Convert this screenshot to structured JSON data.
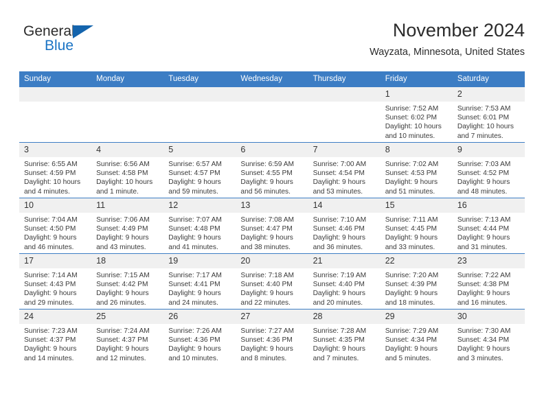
{
  "logo": {
    "word1": "General",
    "word2": "Blue",
    "triangle_color": "#1464ad",
    "blue_color": "#1a73c4"
  },
  "header": {
    "title": "November 2024",
    "subtitle": "Wayzata, Minnesota, United States"
  },
  "theme": {
    "header_bar": "#3c7dc4",
    "daynum_strip": "#f0f0f0",
    "text": "#333333"
  },
  "weekdays": [
    "Sunday",
    "Monday",
    "Tuesday",
    "Wednesday",
    "Thursday",
    "Friday",
    "Saturday"
  ],
  "weeks": [
    [
      {
        "day": "",
        "sunrise": "",
        "sunset": "",
        "daylight": ""
      },
      {
        "day": "",
        "sunrise": "",
        "sunset": "",
        "daylight": ""
      },
      {
        "day": "",
        "sunrise": "",
        "sunset": "",
        "daylight": ""
      },
      {
        "day": "",
        "sunrise": "",
        "sunset": "",
        "daylight": ""
      },
      {
        "day": "",
        "sunrise": "",
        "sunset": "",
        "daylight": ""
      },
      {
        "day": "1",
        "sunrise": "Sunrise: 7:52 AM",
        "sunset": "Sunset: 6:02 PM",
        "daylight": "Daylight: 10 hours and 10 minutes."
      },
      {
        "day": "2",
        "sunrise": "Sunrise: 7:53 AM",
        "sunset": "Sunset: 6:01 PM",
        "daylight": "Daylight: 10 hours and 7 minutes."
      }
    ],
    [
      {
        "day": "3",
        "sunrise": "Sunrise: 6:55 AM",
        "sunset": "Sunset: 4:59 PM",
        "daylight": "Daylight: 10 hours and 4 minutes."
      },
      {
        "day": "4",
        "sunrise": "Sunrise: 6:56 AM",
        "sunset": "Sunset: 4:58 PM",
        "daylight": "Daylight: 10 hours and 1 minute."
      },
      {
        "day": "5",
        "sunrise": "Sunrise: 6:57 AM",
        "sunset": "Sunset: 4:57 PM",
        "daylight": "Daylight: 9 hours and 59 minutes."
      },
      {
        "day": "6",
        "sunrise": "Sunrise: 6:59 AM",
        "sunset": "Sunset: 4:55 PM",
        "daylight": "Daylight: 9 hours and 56 minutes."
      },
      {
        "day": "7",
        "sunrise": "Sunrise: 7:00 AM",
        "sunset": "Sunset: 4:54 PM",
        "daylight": "Daylight: 9 hours and 53 minutes."
      },
      {
        "day": "8",
        "sunrise": "Sunrise: 7:02 AM",
        "sunset": "Sunset: 4:53 PM",
        "daylight": "Daylight: 9 hours and 51 minutes."
      },
      {
        "day": "9",
        "sunrise": "Sunrise: 7:03 AM",
        "sunset": "Sunset: 4:52 PM",
        "daylight": "Daylight: 9 hours and 48 minutes."
      }
    ],
    [
      {
        "day": "10",
        "sunrise": "Sunrise: 7:04 AM",
        "sunset": "Sunset: 4:50 PM",
        "daylight": "Daylight: 9 hours and 46 minutes."
      },
      {
        "day": "11",
        "sunrise": "Sunrise: 7:06 AM",
        "sunset": "Sunset: 4:49 PM",
        "daylight": "Daylight: 9 hours and 43 minutes."
      },
      {
        "day": "12",
        "sunrise": "Sunrise: 7:07 AM",
        "sunset": "Sunset: 4:48 PM",
        "daylight": "Daylight: 9 hours and 41 minutes."
      },
      {
        "day": "13",
        "sunrise": "Sunrise: 7:08 AM",
        "sunset": "Sunset: 4:47 PM",
        "daylight": "Daylight: 9 hours and 38 minutes."
      },
      {
        "day": "14",
        "sunrise": "Sunrise: 7:10 AM",
        "sunset": "Sunset: 4:46 PM",
        "daylight": "Daylight: 9 hours and 36 minutes."
      },
      {
        "day": "15",
        "sunrise": "Sunrise: 7:11 AM",
        "sunset": "Sunset: 4:45 PM",
        "daylight": "Daylight: 9 hours and 33 minutes."
      },
      {
        "day": "16",
        "sunrise": "Sunrise: 7:13 AM",
        "sunset": "Sunset: 4:44 PM",
        "daylight": "Daylight: 9 hours and 31 minutes."
      }
    ],
    [
      {
        "day": "17",
        "sunrise": "Sunrise: 7:14 AM",
        "sunset": "Sunset: 4:43 PM",
        "daylight": "Daylight: 9 hours and 29 minutes."
      },
      {
        "day": "18",
        "sunrise": "Sunrise: 7:15 AM",
        "sunset": "Sunset: 4:42 PM",
        "daylight": "Daylight: 9 hours and 26 minutes."
      },
      {
        "day": "19",
        "sunrise": "Sunrise: 7:17 AM",
        "sunset": "Sunset: 4:41 PM",
        "daylight": "Daylight: 9 hours and 24 minutes."
      },
      {
        "day": "20",
        "sunrise": "Sunrise: 7:18 AM",
        "sunset": "Sunset: 4:40 PM",
        "daylight": "Daylight: 9 hours and 22 minutes."
      },
      {
        "day": "21",
        "sunrise": "Sunrise: 7:19 AM",
        "sunset": "Sunset: 4:40 PM",
        "daylight": "Daylight: 9 hours and 20 minutes."
      },
      {
        "day": "22",
        "sunrise": "Sunrise: 7:20 AM",
        "sunset": "Sunset: 4:39 PM",
        "daylight": "Daylight: 9 hours and 18 minutes."
      },
      {
        "day": "23",
        "sunrise": "Sunrise: 7:22 AM",
        "sunset": "Sunset: 4:38 PM",
        "daylight": "Daylight: 9 hours and 16 minutes."
      }
    ],
    [
      {
        "day": "24",
        "sunrise": "Sunrise: 7:23 AM",
        "sunset": "Sunset: 4:37 PM",
        "daylight": "Daylight: 9 hours and 14 minutes."
      },
      {
        "day": "25",
        "sunrise": "Sunrise: 7:24 AM",
        "sunset": "Sunset: 4:37 PM",
        "daylight": "Daylight: 9 hours and 12 minutes."
      },
      {
        "day": "26",
        "sunrise": "Sunrise: 7:26 AM",
        "sunset": "Sunset: 4:36 PM",
        "daylight": "Daylight: 9 hours and 10 minutes."
      },
      {
        "day": "27",
        "sunrise": "Sunrise: 7:27 AM",
        "sunset": "Sunset: 4:36 PM",
        "daylight": "Daylight: 9 hours and 8 minutes."
      },
      {
        "day": "28",
        "sunrise": "Sunrise: 7:28 AM",
        "sunset": "Sunset: 4:35 PM",
        "daylight": "Daylight: 9 hours and 7 minutes."
      },
      {
        "day": "29",
        "sunrise": "Sunrise: 7:29 AM",
        "sunset": "Sunset: 4:34 PM",
        "daylight": "Daylight: 9 hours and 5 minutes."
      },
      {
        "day": "30",
        "sunrise": "Sunrise: 7:30 AM",
        "sunset": "Sunset: 4:34 PM",
        "daylight": "Daylight: 9 hours and 3 minutes."
      }
    ]
  ]
}
